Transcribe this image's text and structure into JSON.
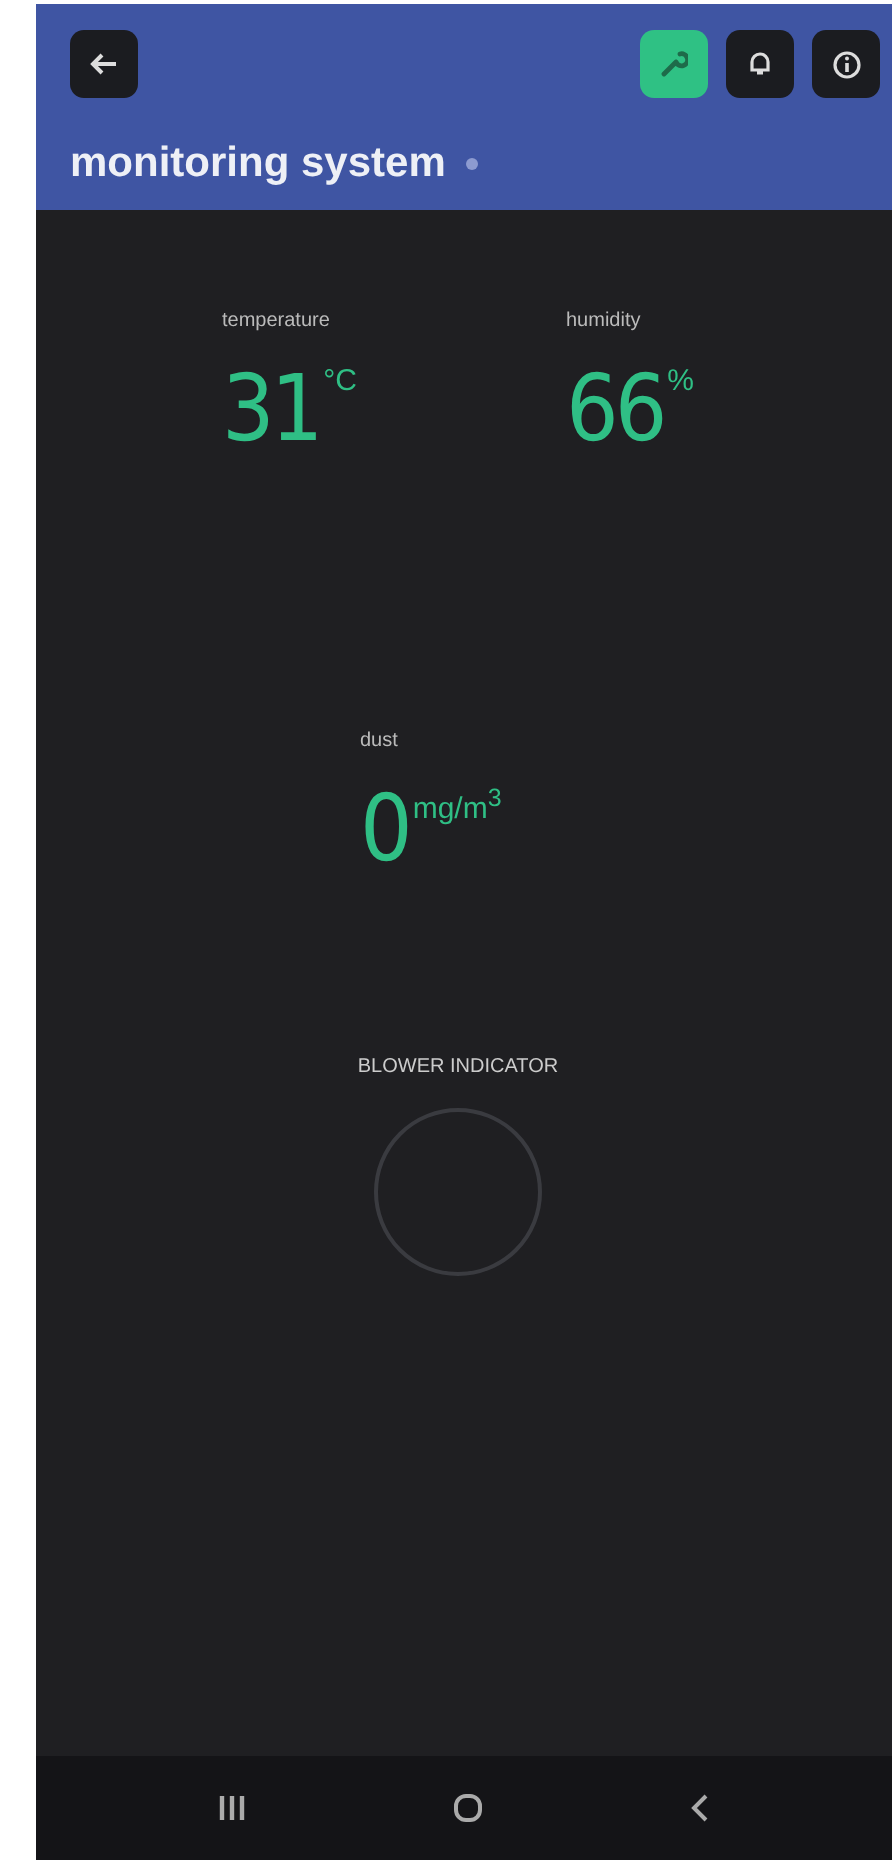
{
  "header": {
    "title": "monitoring system",
    "connected": false,
    "toolbar": [
      {
        "kind": "wrench",
        "selected": true
      },
      {
        "kind": "bell",
        "selected": false
      },
      {
        "kind": "info",
        "selected": false
      }
    ]
  },
  "readings": [
    {
      "label": "temperature",
      "value": "31",
      "unit": "°C"
    },
    {
      "label": "humidity",
      "value": "66",
      "unit": "%"
    },
    {
      "label": "dust",
      "value": "0",
      "unit": "mg/m$^{3}$"
    }
  ],
  "blower": {
    "label": "BLOWER INDICATOR",
    "on": false
  }
}
